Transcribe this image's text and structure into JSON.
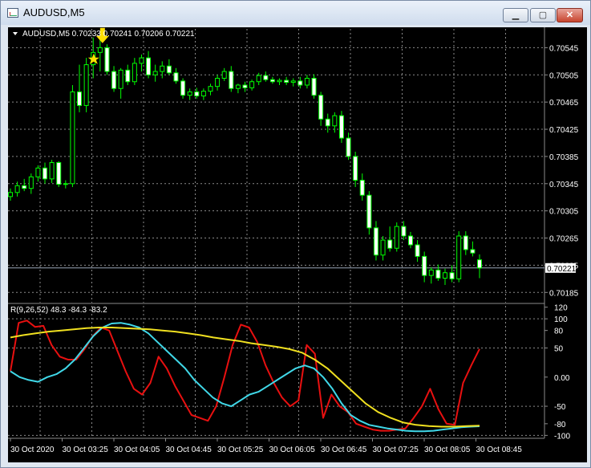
{
  "window": {
    "title": "AUDUSD,M5",
    "minimize_glyph": "▁",
    "maximize_glyph": "▢",
    "close_glyph": "✕"
  },
  "main_pane": {
    "header": "AUDUSD,M5  0.70233 0.70241 0.70206 0.70221",
    "current_price_label": "0.70221",
    "price_ticks": [
      "0.70545",
      "0.70505",
      "0.70465",
      "0.70425",
      "0.70385",
      "0.70345",
      "0.70305",
      "0.70265",
      "0.70225",
      "0.70185"
    ]
  },
  "indicator_pane": {
    "header": "R(9,26,52) 48.3 -84.3 -83.2",
    "ticks": [
      "120",
      "100",
      "80",
      "50",
      "0.00",
      "-50",
      "-80",
      "-100"
    ]
  },
  "time_axis": [
    "30 Oct 2020",
    "30 Oct 03:25",
    "30 Oct 04:05",
    "30 Oct 04:45",
    "30 Oct 05:25",
    "30 Oct 06:05",
    "30 Oct 06:45",
    "30 Oct 07:25",
    "30 Oct 08:05",
    "30 Oct 08:45"
  ],
  "colors": {
    "background": "#000000",
    "grid": "#8a8a8a",
    "bull_candle": "#00ff00",
    "bear_candle": "#ffffff",
    "price_line": "#9aa6b8",
    "fast_line": "#e81010",
    "mid_line": "#40d8e8",
    "slow_line": "#f0e020",
    "signal_marker": "#ffe000"
  },
  "icons": {
    "signal_arrow": "down-arrow-icon",
    "signal_star": "star-icon",
    "header_triangle": "triangle-down-icon"
  },
  "chart_data": [
    {
      "type": "candlestick",
      "title": "AUDUSD,M5",
      "ohlc_last": {
        "open": 0.70233,
        "high": 0.70241,
        "low": 0.70206,
        "close": 0.70221
      },
      "ylim": [
        0.7017,
        0.70575
      ],
      "current_price": 0.70221,
      "candles": [
        [
          0.70326,
          0.70338,
          0.7032,
          0.70332
        ],
        [
          0.70332,
          0.70348,
          0.70326,
          0.70342
        ],
        [
          0.70342,
          0.70352,
          0.70334,
          0.70338
        ],
        [
          0.70338,
          0.7036,
          0.7033,
          0.70355
        ],
        [
          0.70355,
          0.70372,
          0.70348,
          0.70368
        ],
        [
          0.70368,
          0.70376,
          0.70345,
          0.70352
        ],
        [
          0.70352,
          0.7038,
          0.70346,
          0.70376
        ],
        [
          0.70376,
          0.70378,
          0.7034,
          0.70344
        ],
        [
          0.70344,
          0.7035,
          0.70338,
          0.70345
        ],
        [
          0.70345,
          0.7049,
          0.7034,
          0.7048
        ],
        [
          0.7048,
          0.7052,
          0.7045,
          0.7046
        ],
        [
          0.7046,
          0.7053,
          0.7045,
          0.7052
        ],
        [
          0.7052,
          0.7056,
          0.705,
          0.70538
        ],
        [
          0.70538,
          0.7056,
          0.7051,
          0.70545
        ],
        [
          0.70545,
          0.7055,
          0.70505,
          0.7051
        ],
        [
          0.7051,
          0.70518,
          0.7048,
          0.70485
        ],
        [
          0.70485,
          0.70515,
          0.7047,
          0.70512
        ],
        [
          0.70512,
          0.7052,
          0.7049,
          0.70495
        ],
        [
          0.70495,
          0.7053,
          0.7049,
          0.70522
        ],
        [
          0.70522,
          0.70535,
          0.7051,
          0.7053
        ],
        [
          0.7053,
          0.7054,
          0.705,
          0.70505
        ],
        [
          0.70505,
          0.7052,
          0.70495,
          0.7051
        ],
        [
          0.7051,
          0.70525,
          0.705,
          0.70518
        ],
        [
          0.70518,
          0.70528,
          0.70505,
          0.70508
        ],
        [
          0.70508,
          0.70515,
          0.70492,
          0.70496
        ],
        [
          0.70496,
          0.705,
          0.7047,
          0.70475
        ],
        [
          0.70475,
          0.70485,
          0.70468,
          0.7048
        ],
        [
          0.7048,
          0.70486,
          0.7047,
          0.70474
        ],
        [
          0.70474,
          0.70485,
          0.70468,
          0.70481
        ],
        [
          0.70481,
          0.70492,
          0.70475,
          0.70488
        ],
        [
          0.70488,
          0.70505,
          0.70482,
          0.705
        ],
        [
          0.705,
          0.70515,
          0.70496,
          0.7051
        ],
        [
          0.7051,
          0.70518,
          0.7048,
          0.70485
        ],
        [
          0.70485,
          0.70492,
          0.70478,
          0.7049
        ],
        [
          0.7049,
          0.70495,
          0.7048,
          0.70486
        ],
        [
          0.70486,
          0.70498,
          0.70482,
          0.70495
        ],
        [
          0.70495,
          0.70508,
          0.7049,
          0.70504
        ],
        [
          0.70504,
          0.7051,
          0.70495,
          0.70498
        ],
        [
          0.70498,
          0.70502,
          0.70492,
          0.70495
        ],
        [
          0.70495,
          0.705,
          0.7049,
          0.70497
        ],
        [
          0.70497,
          0.70502,
          0.7049,
          0.70494
        ],
        [
          0.70494,
          0.705,
          0.70488,
          0.70496
        ],
        [
          0.70496,
          0.70502,
          0.70485,
          0.7049
        ],
        [
          0.7049,
          0.70505,
          0.70485,
          0.705
        ],
        [
          0.705,
          0.70506,
          0.7047,
          0.70475
        ],
        [
          0.70475,
          0.7048,
          0.7043,
          0.7044
        ],
        [
          0.7044,
          0.70448,
          0.7042,
          0.7043
        ],
        [
          0.7043,
          0.7045,
          0.7042,
          0.70445
        ],
        [
          0.70445,
          0.70452,
          0.70405,
          0.70412
        ],
        [
          0.70412,
          0.7042,
          0.7038,
          0.70385
        ],
        [
          0.70385,
          0.70392,
          0.7034,
          0.7035
        ],
        [
          0.7035,
          0.7036,
          0.7032,
          0.70328
        ],
        [
          0.70328,
          0.70334,
          0.7027,
          0.7028
        ],
        [
          0.7028,
          0.7029,
          0.70232,
          0.7024
        ],
        [
          0.7024,
          0.70268,
          0.70232,
          0.70262
        ],
        [
          0.70262,
          0.70282,
          0.70245,
          0.7025
        ],
        [
          0.7025,
          0.70288,
          0.70245,
          0.70282
        ],
        [
          0.70282,
          0.7029,
          0.70262,
          0.70268
        ],
        [
          0.70268,
          0.70274,
          0.7025,
          0.70255
        ],
        [
          0.70255,
          0.70262,
          0.7023,
          0.70238
        ],
        [
          0.70238,
          0.70245,
          0.702,
          0.7021
        ],
        [
          0.7021,
          0.70222,
          0.70198,
          0.70218
        ],
        [
          0.70218,
          0.70226,
          0.70202,
          0.70206
        ],
        [
          0.70206,
          0.7022,
          0.70196,
          0.70214
        ],
        [
          0.70214,
          0.70225,
          0.702,
          0.70205
        ],
        [
          0.70205,
          0.70275,
          0.702,
          0.70268
        ],
        [
          0.70268,
          0.70275,
          0.7024,
          0.70248
        ],
        [
          0.70248,
          0.7026,
          0.70238,
          0.70243
        ],
        [
          0.70233,
          0.70241,
          0.70206,
          0.70221
        ]
      ]
    },
    {
      "type": "line",
      "title": "R(9,26,52)",
      "last_values": [
        48.3,
        -84.3,
        -83.2
      ],
      "ylim": [
        -105,
        125
      ],
      "series": [
        {
          "color": "#e81010",
          "values": [
            10,
            93,
            97,
            86,
            88,
            55,
            35,
            30,
            30,
            48,
            70,
            85,
            80,
            45,
            10,
            -20,
            -30,
            -10,
            35,
            15,
            -15,
            -40,
            -65,
            -70,
            -75,
            -50,
            0,
            55,
            90,
            85,
            60,
            20,
            -10,
            -35,
            -50,
            -40,
            55,
            40,
            -70,
            -30,
            -50,
            -60,
            -80,
            -85,
            -90,
            -92,
            -92,
            -90,
            -88,
            -70,
            -50,
            -20,
            -55,
            -80,
            -82,
            -10,
            20,
            48.3
          ]
        },
        {
          "color": "#40d8e8",
          "values": [
            10,
            0,
            -5,
            -8,
            0,
            5,
            15,
            30,
            50,
            70,
            85,
            92,
            93,
            90,
            85,
            75,
            60,
            45,
            30,
            15,
            -5,
            -20,
            -35,
            -45,
            -50,
            -40,
            -30,
            -25,
            -15,
            -5,
            5,
            15,
            20,
            15,
            0,
            -20,
            -45,
            -65,
            -75,
            -82,
            -85,
            -88,
            -90,
            -92,
            -93,
            -93,
            -92,
            -90,
            -88,
            -86,
            -85,
            -84.3
          ]
        },
        {
          "color": "#f0e020",
          "values": [
            68,
            72,
            75,
            78,
            80,
            82,
            84,
            85,
            85,
            84,
            83,
            82,
            80,
            78,
            75,
            72,
            68,
            65,
            62,
            58,
            55,
            52,
            48,
            42,
            30,
            15,
            -5,
            -25,
            -45,
            -60,
            -70,
            -78,
            -82,
            -84,
            -85,
            -85,
            -84,
            -83.2
          ]
        }
      ]
    }
  ]
}
